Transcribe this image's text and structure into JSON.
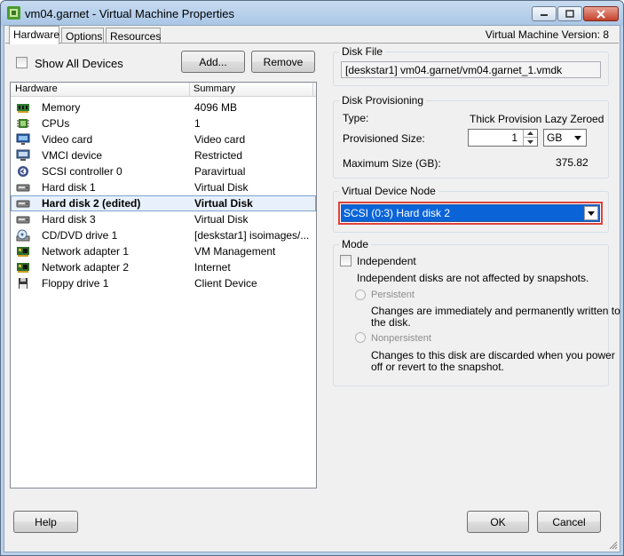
{
  "window": {
    "title": "vm04.garnet - Virtual Machine Properties",
    "version_label": "Virtual Machine Version: 8"
  },
  "tabs": [
    {
      "label": "Hardware",
      "active": true
    },
    {
      "label": "Options",
      "active": false
    },
    {
      "label": "Resources",
      "active": false
    }
  ],
  "hardware": {
    "show_all_devices_label": "Show All Devices",
    "add_label": "Add...",
    "remove_label": "Remove",
    "col_hardware": "Hardware",
    "col_summary": "Summary",
    "rows": [
      {
        "name": "Memory",
        "summary": "4096 MB",
        "icon": "memory-icon"
      },
      {
        "name": "CPUs",
        "summary": "1",
        "icon": "cpu-icon"
      },
      {
        "name": "Video card",
        "summary": "Video card",
        "icon": "monitor-icon"
      },
      {
        "name": "VMCI device",
        "summary": "Restricted",
        "icon": "vmci-device-icon"
      },
      {
        "name": "SCSI controller 0",
        "summary": "Paravirtual",
        "icon": "scsi-controller-icon"
      },
      {
        "name": "Hard disk 1",
        "summary": "Virtual Disk",
        "icon": "hard-disk-icon"
      },
      {
        "name": "Hard disk 2 (edited)",
        "summary": "Virtual Disk",
        "icon": "hard-disk-icon",
        "selected": true
      },
      {
        "name": "Hard disk 3",
        "summary": "Virtual Disk",
        "icon": "hard-disk-icon"
      },
      {
        "name": "CD/DVD drive 1",
        "summary": "[deskstar1] isoimages/...",
        "icon": "cd-dvd-icon"
      },
      {
        "name": "Network adapter 1",
        "summary": "VM Management",
        "icon": "network-adapter-icon"
      },
      {
        "name": "Network adapter 2",
        "summary": "Internet",
        "icon": "network-adapter-icon"
      },
      {
        "name": "Floppy drive 1",
        "summary": "Client Device",
        "icon": "floppy-drive-icon"
      }
    ]
  },
  "disk_file": {
    "title": "Disk File",
    "path": "[deskstar1] vm04.garnet/vm04.garnet_1.vmdk"
  },
  "disk_provisioning": {
    "title": "Disk Provisioning",
    "type_label": "Type:",
    "type_value": "Thick Provision Lazy Zeroed",
    "size_label": "Provisioned Size:",
    "size_value": "1",
    "unit_value": "GB",
    "max_label": "Maximum Size (GB):",
    "max_value": "375.82"
  },
  "virtual_device_node": {
    "title": "Virtual Device Node",
    "selected": "SCSI (0:3) Hard disk 2"
  },
  "mode": {
    "title": "Mode",
    "independent_label": "Independent",
    "independent_desc": "Independent disks are not affected by snapshots.",
    "persistent_label": "Persistent",
    "persistent_desc_1": "Changes are immediately and permanently written to",
    "persistent_desc_2": "the disk.",
    "nonpersistent_label": "Nonpersistent",
    "nonpersistent_desc_1": "Changes to this disk are discarded when you power",
    "nonpersistent_desc_2": "off or revert to the snapshot."
  },
  "footer": {
    "help_label": "Help",
    "ok_label": "OK",
    "cancel_label": "Cancel"
  },
  "colors": {
    "selection": "#e8f1fb",
    "combo_selected_bg": "#0a64d8",
    "highlight_border": "#e0413a"
  }
}
